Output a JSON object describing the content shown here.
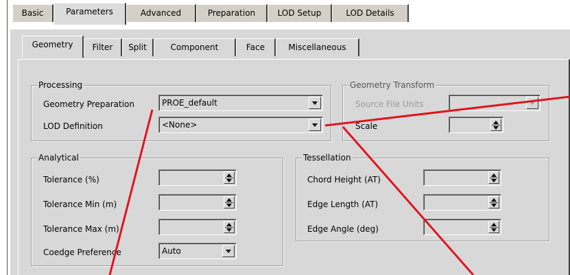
{
  "outer_tabs": [
    "Basic",
    "Parameters",
    "Advanced",
    "Preparation",
    "LOD Setup",
    "LOD Details"
  ],
  "outer_active": "Parameters",
  "inner_tabs": [
    "Geometry",
    "Filter",
    "Split",
    "Component",
    "Face",
    "Miscellaneous"
  ],
  "inner_active": "Geometry",
  "processing": {
    "title": "Processing",
    "geom_prep_label": "Geometry Preparation",
    "geom_prep_value": "PROE_default",
    "lod_def_label": "LOD Definition",
    "lod_def_value": "<None>"
  },
  "transform": {
    "title": "Geometry Transform",
    "src_units_label": "Source File Units",
    "src_units_value": "",
    "scale_label": "Scale",
    "scale_value": ""
  },
  "analytical": {
    "title": "Analytical",
    "tolerance_label": "Tolerance (%)",
    "tolerance_min_label": "Tolerance Min (m)",
    "tolerance_max_label": "Tolerance Max (m)",
    "coedge_label": "Coedge Preference",
    "coedge_value": "Auto"
  },
  "tessellation": {
    "title": "Tessellation",
    "chord_label": "Chord Height (AT)",
    "edge_len_label": "Edge Length (AT)",
    "edge_ang_label": "Edge Angle (deg)"
  },
  "colors": {
    "panel": "#d8d8d8",
    "annotation": "#e0141e"
  }
}
